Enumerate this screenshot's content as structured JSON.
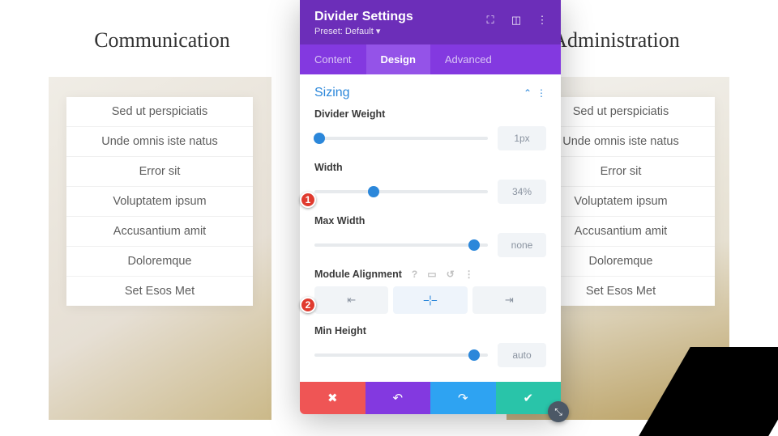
{
  "columns": {
    "left_title": "Communication",
    "right_title": "Administration",
    "items": [
      "Sed ut perspiciatis",
      "Unde omnis iste natus",
      "Error sit",
      "Voluptatem ipsum",
      "Accusantium amit",
      "Doloremque",
      "Set Esos Met"
    ]
  },
  "modal": {
    "title": "Divider Settings",
    "preset_label": "Preset: Default ▾",
    "tabs": {
      "content": "Content",
      "design": "Design",
      "advanced": "Advanced"
    },
    "section": "Sizing",
    "fields": {
      "weight": {
        "label": "Divider Weight",
        "value": "1px",
        "percent": 3
      },
      "width": {
        "label": "Width",
        "value": "34%",
        "percent": 34
      },
      "maxwidth": {
        "label": "Max Width",
        "value": "none",
        "percent": 92
      },
      "align": {
        "label": "Module Alignment",
        "options": [
          "left",
          "center",
          "right"
        ],
        "selected": "center"
      },
      "minheight": {
        "label": "Min Height",
        "value": "auto",
        "percent": 92
      }
    }
  },
  "markers": [
    "1",
    "2"
  ]
}
